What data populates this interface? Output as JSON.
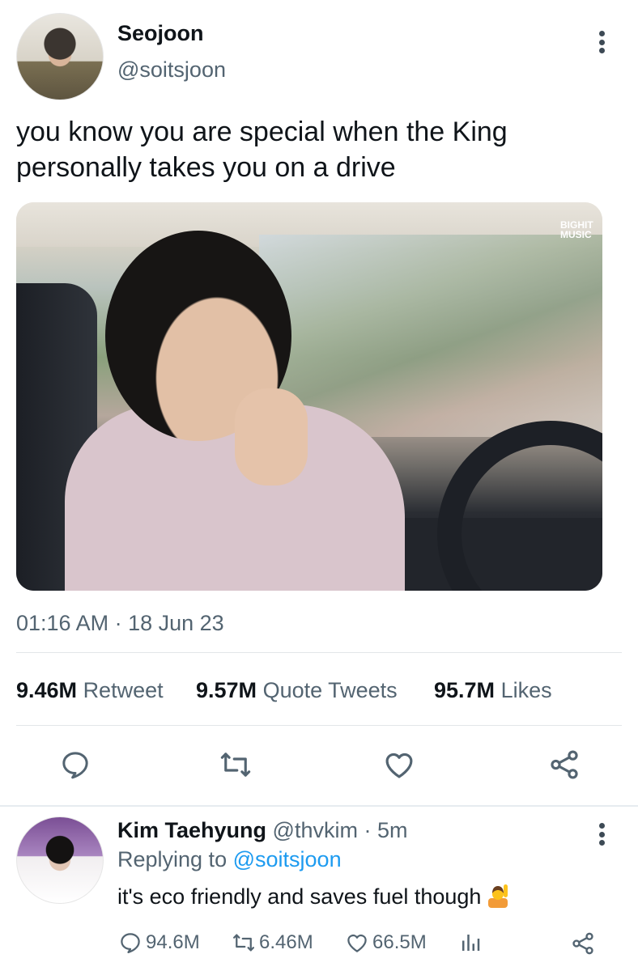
{
  "tweet": {
    "author_name": "Seojoon",
    "author_handle": "@soitsjoon",
    "text": "you know you are special when the King personally takes you on a drive",
    "media_watermark": "BIGHIT MUSIC",
    "timestamp": "01:16 AM · 18 Jun 23",
    "stats": [
      {
        "count": "9.46M",
        "label": "Retweet"
      },
      {
        "count": "9.57M",
        "label": "Quote Tweets"
      },
      {
        "count": "95.7M",
        "label": "Likes"
      }
    ],
    "actions": [
      "reply-icon",
      "retweet-icon",
      "like-icon",
      "share-icon"
    ]
  },
  "reply": {
    "author_name": "Kim Taehyung",
    "meta": "@thvkim · 5m",
    "replying_prefix": "Replying to",
    "replying_to": "@soitsjoon",
    "text": "it's eco friendly and saves fuel though",
    "emoji": "person-raising-hand-emoji",
    "counts": {
      "replies": "94.6M",
      "retweets": "6.46M",
      "likes": "66.5M"
    }
  },
  "colors": {
    "text_primary": "#0f1419",
    "text_secondary": "#536471",
    "link": "#1d9bf0",
    "divider": "#e2e6e9"
  }
}
